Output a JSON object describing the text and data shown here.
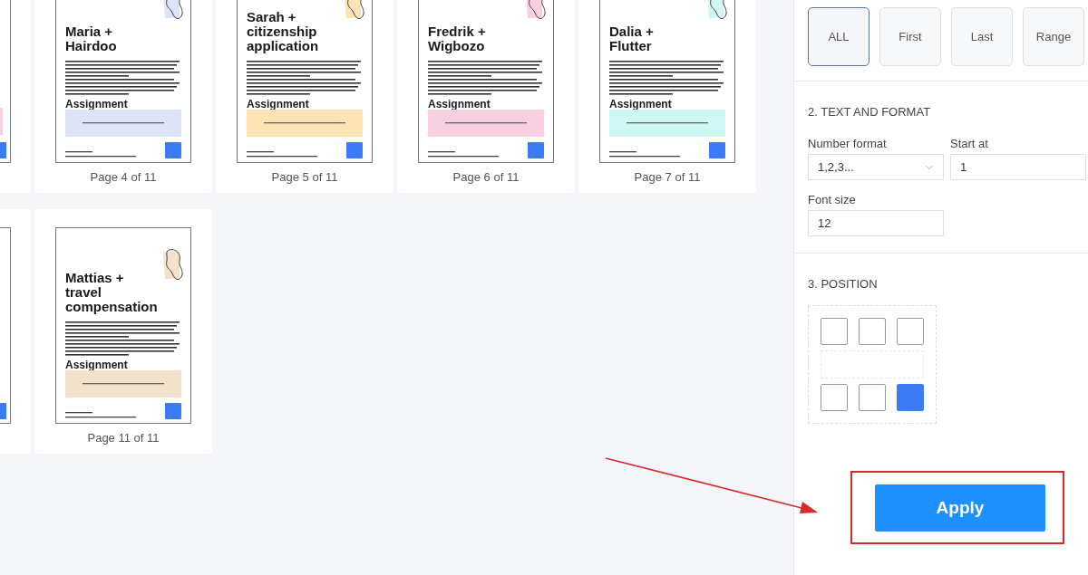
{
  "pages": [
    {
      "kind": "partial",
      "color": "#f8cfe0"
    },
    {
      "kind": "page",
      "label": "Page 4 of 11",
      "title_lines": [
        "Maria +",
        "Hairdoo"
      ],
      "section": "Assignment",
      "color": "#dfe3f7"
    },
    {
      "kind": "page",
      "label": "Page 5 of 11",
      "title_lines": [
        "Sarah +",
        "citizenship",
        "application"
      ],
      "section": "Assignment",
      "color": "#fde3b3"
    },
    {
      "kind": "page",
      "label": "Page 6 of 11",
      "title_lines": [
        "Fredrik +",
        "Wigbozo"
      ],
      "section": "Assignment",
      "color": "#f8cfe0"
    },
    {
      "kind": "page",
      "label": "Page 7 of 11",
      "title_lines": [
        "Dalia +",
        "Flutter"
      ],
      "section": "Assignment",
      "color": "#cff8f5"
    },
    {
      "kind": "partial",
      "color": "#ffffff"
    },
    {
      "kind": "page",
      "label": "Page 11 of 11",
      "title_lines": [
        "Mattias +",
        "travel",
        "compensation"
      ],
      "section": "Assignment",
      "color": "#f3e2cb"
    }
  ],
  "panel": {
    "page_modes": [
      {
        "label": "ALL",
        "selected": true
      },
      {
        "label": "First",
        "selected": false
      },
      {
        "label": "Last",
        "selected": false
      },
      {
        "label": "Range",
        "selected": false
      }
    ],
    "text_section": "2. TEXT AND FORMAT",
    "number_format": {
      "label": "Number format",
      "value": "1,2,3..."
    },
    "start_at": {
      "label": "Start at",
      "value": "1"
    },
    "font_size": {
      "label": "Font size",
      "value": "12"
    },
    "position_section": "3. POSITION",
    "positions": [
      {
        "selected": false
      },
      {
        "selected": false
      },
      {
        "selected": false
      },
      {
        "selected": false
      },
      {
        "selected": false
      },
      {
        "selected": true
      }
    ],
    "apply": "Apply"
  }
}
